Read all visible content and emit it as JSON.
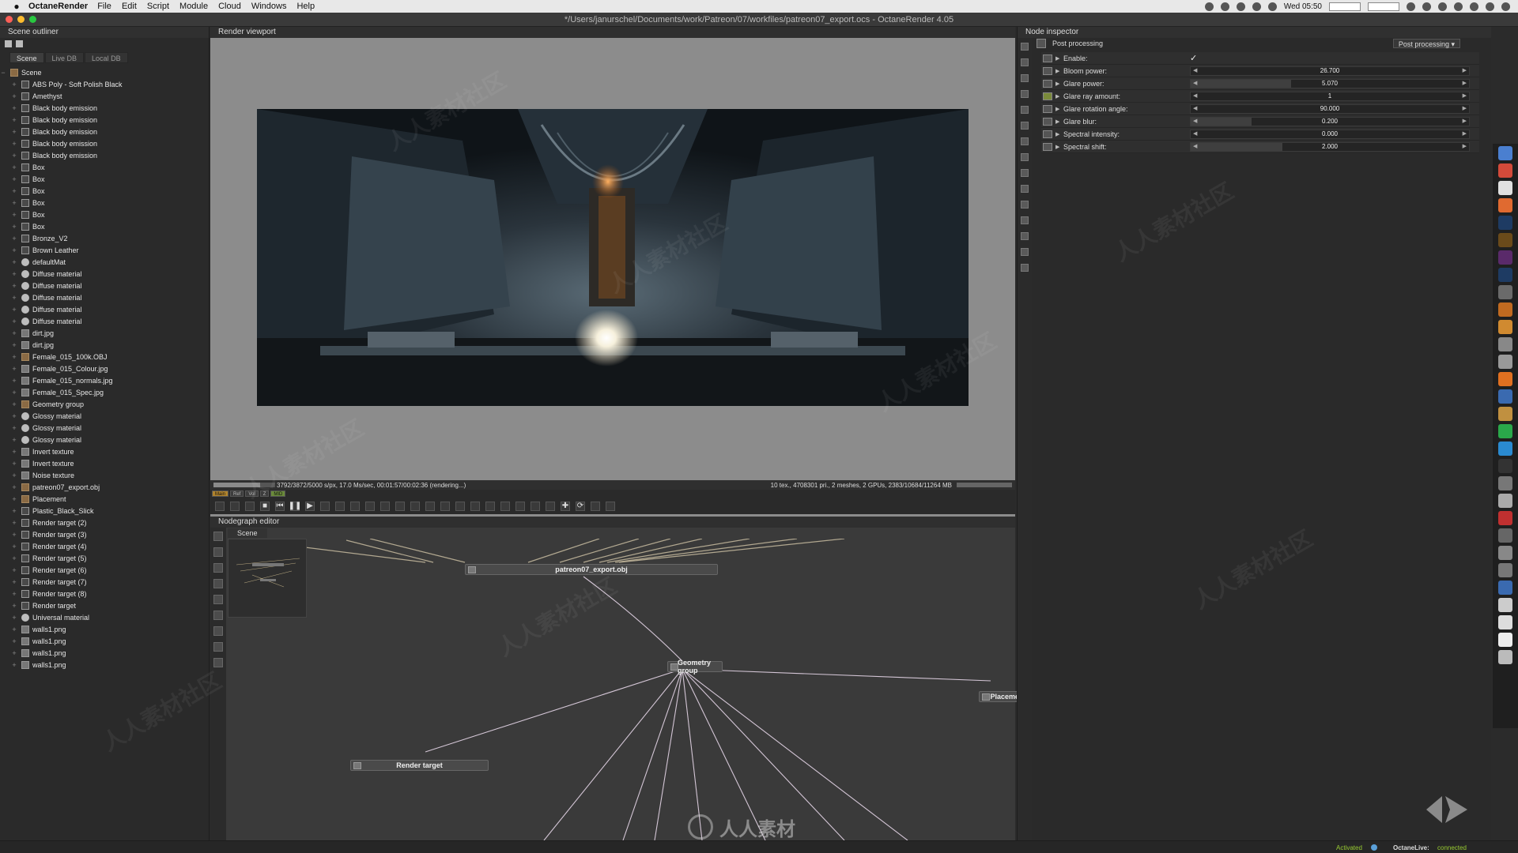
{
  "menubar": {
    "app_name": "OctaneRender",
    "items": [
      "File",
      "Edit",
      "Script",
      "Module",
      "Cloud",
      "Windows",
      "Help"
    ],
    "clock": "Wed 05:50"
  },
  "window": {
    "title": "*/Users/janurschel/Documents/work/Patreon/07/workfiles/patreon07_export.ocs - OctaneRender 4.05"
  },
  "outliner": {
    "title": "Scene outliner",
    "tabs": [
      "Scene",
      "Live DB",
      "Local DB"
    ],
    "root": "Scene",
    "items": [
      {
        "label": "ABS Poly - Soft Polish Black",
        "icon": "material"
      },
      {
        "label": "Amethyst",
        "icon": "material"
      },
      {
        "label": "Black body emission",
        "icon": "emission"
      },
      {
        "label": "Black body emission",
        "icon": "emission"
      },
      {
        "label": "Black body emission",
        "icon": "emission"
      },
      {
        "label": "Black body emission",
        "icon": "emission"
      },
      {
        "label": "Black body emission",
        "icon": "emission"
      },
      {
        "label": "Box",
        "icon": "box"
      },
      {
        "label": "Box",
        "icon": "box"
      },
      {
        "label": "Box",
        "icon": "box"
      },
      {
        "label": "Box",
        "icon": "box"
      },
      {
        "label": "Box",
        "icon": "box"
      },
      {
        "label": "Box",
        "icon": "box"
      },
      {
        "label": "Bronze_V2",
        "icon": "material"
      },
      {
        "label": "Brown Leather",
        "icon": "material"
      },
      {
        "label": "defaultMat",
        "icon": "sphere"
      },
      {
        "label": "Diffuse material",
        "icon": "sphere"
      },
      {
        "label": "Diffuse material",
        "icon": "sphere"
      },
      {
        "label": "Diffuse material",
        "icon": "sphere"
      },
      {
        "label": "Diffuse material",
        "icon": "sphere"
      },
      {
        "label": "Diffuse material",
        "icon": "sphere"
      },
      {
        "label": "dirt.jpg",
        "icon": "image"
      },
      {
        "label": "dirt.jpg",
        "icon": "image"
      },
      {
        "label": "Female_015_100k.OBJ",
        "icon": "geometry"
      },
      {
        "label": "Female_015_Colour.jpg",
        "icon": "image"
      },
      {
        "label": "Female_015_normals.jpg",
        "icon": "image"
      },
      {
        "label": "Female_015_Spec.jpg",
        "icon": "image"
      },
      {
        "label": "Geometry group",
        "icon": "geometry"
      },
      {
        "label": "Glossy material",
        "icon": "sphere"
      },
      {
        "label": "Glossy material",
        "icon": "sphere"
      },
      {
        "label": "Glossy material",
        "icon": "sphere"
      },
      {
        "label": "Invert texture",
        "icon": "image"
      },
      {
        "label": "Invert texture",
        "icon": "image"
      },
      {
        "label": "Noise texture",
        "icon": "image"
      },
      {
        "label": "patreon07_export.obj",
        "icon": "geometry"
      },
      {
        "label": "Placement",
        "icon": "geometry"
      },
      {
        "label": "Plastic_Black_Slick",
        "icon": "material"
      },
      {
        "label": "Render target (2)",
        "icon": "box"
      },
      {
        "label": "Render target (3)",
        "icon": "box"
      },
      {
        "label": "Render target (4)",
        "icon": "box"
      },
      {
        "label": "Render target (5)",
        "icon": "box"
      },
      {
        "label": "Render target (6)",
        "icon": "box"
      },
      {
        "label": "Render target (7)",
        "icon": "box"
      },
      {
        "label": "Render target (8)",
        "icon": "box"
      },
      {
        "label": "Render target",
        "icon": "box"
      },
      {
        "label": "Universal material",
        "icon": "sphere"
      },
      {
        "label": "walls1.png",
        "icon": "image"
      },
      {
        "label": "walls1.png",
        "icon": "image"
      },
      {
        "label": "walls1.png",
        "icon": "image"
      },
      {
        "label": "walls1.png",
        "icon": "image"
      }
    ]
  },
  "viewport": {
    "title": "Render viewport",
    "status_left": "3792/3872/5000 s/px, 17.0 Ms/sec, 00:01:57/00:02:36 (rendering...)",
    "status_right": "10 tex., 4708301 pri., 2 meshes, 2 GPUs, 2383/10684/11264 MB",
    "progress": 0.76,
    "modes": [
      "Main",
      "Ref",
      "Vol",
      "Z",
      "MID"
    ]
  },
  "nodegraph": {
    "title": "Nodegraph editor",
    "tab": "Scene",
    "nodes": {
      "obj": "patreon07_export.obj",
      "geo": "Geometry group",
      "place": "Placement",
      "rt": "Render target"
    }
  },
  "inspector": {
    "title": "Node inspector",
    "node_name": "Post processing",
    "node_type": "Post processing",
    "params": [
      {
        "label": "Enable:",
        "type": "check",
        "value": "✓"
      },
      {
        "label": "Bloom power:",
        "type": "slider",
        "value": "26.700",
        "fill": 0.0
      },
      {
        "label": "Glare power:",
        "type": "slider",
        "value": "5.070",
        "fill": 0.36
      },
      {
        "label": "Glare ray amount:",
        "type": "slider",
        "value": "1",
        "fill": 0.0
      },
      {
        "label": "Glare rotation angle:",
        "type": "slider",
        "value": "90.000",
        "fill": 0.0
      },
      {
        "label": "Glare blur:",
        "type": "slider",
        "value": "0.200",
        "fill": 0.22
      },
      {
        "label": "Spectral intensity:",
        "type": "slider",
        "value": "0.000",
        "fill": 0.0
      },
      {
        "label": "Spectral shift:",
        "type": "slider",
        "value": "2.000",
        "fill": 0.33
      }
    ]
  },
  "statusbar": {
    "activated": "Activated",
    "live_label": "OctaneLive:",
    "live_state": "connected"
  },
  "watermark": {
    "text": "人人素材社区",
    "logo_text": "人人素材"
  }
}
